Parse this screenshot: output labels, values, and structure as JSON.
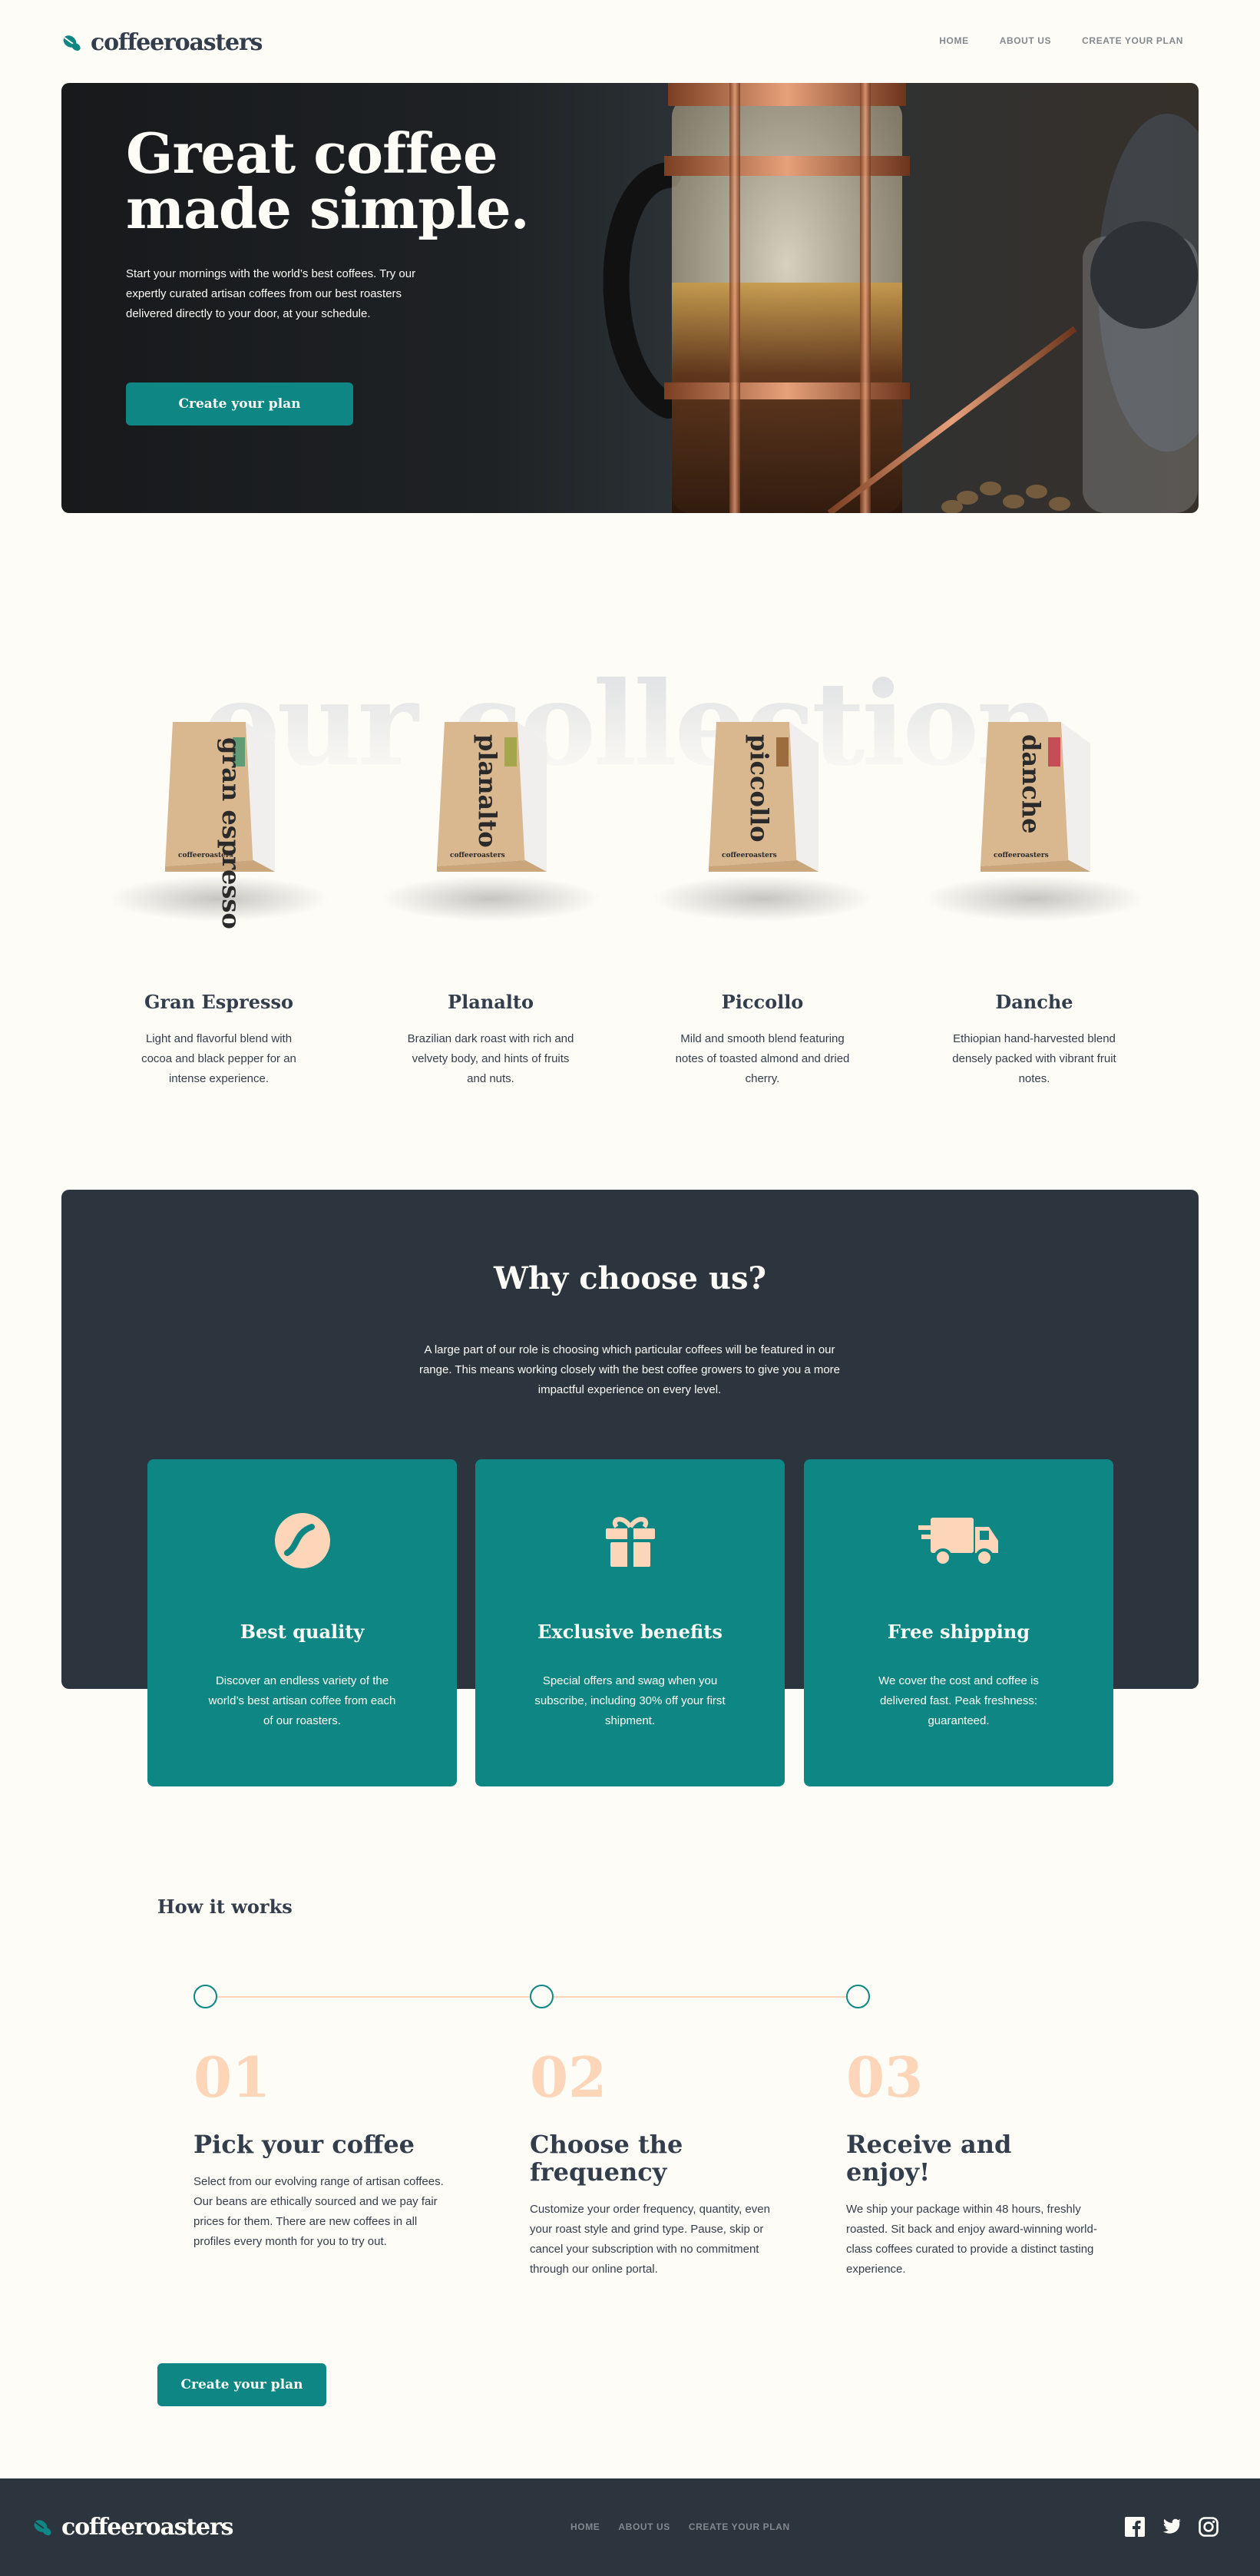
{
  "brand": {
    "name": "coffeeroasters"
  },
  "nav": {
    "home": "HOME",
    "about": "ABOUT US",
    "create": "CREATE YOUR PLAN"
  },
  "hero": {
    "title": "Great coffee made simple.",
    "text": "Start your mornings with the world’s best coffees. Try our expertly curated artisan coffees from our best roasters delivered directly to your door, at your schedule.",
    "button": "Create your plan"
  },
  "collection": {
    "heading": "our collection",
    "items": [
      {
        "bag_label": "gran espresso",
        "name": "Gran Espresso",
        "desc": "Light and flavorful blend with cocoa and black pepper for an intense experience.",
        "tag_color": "#5E9C77"
      },
      {
        "bag_label": "planalto",
        "name": "Planalto",
        "desc": "Brazilian dark roast with rich and velvety body, and hints of fruits and nuts.",
        "tag_color": "#A3A64A"
      },
      {
        "bag_label": "piccollo",
        "name": "Piccollo",
        "desc": "Mild and smooth blend featuring notes of toasted almond and dried cherry.",
        "tag_color": "#9C6B3E"
      },
      {
        "bag_label": "danche",
        "name": "Danche",
        "desc": "Ethiopian hand-harvested blend densely packed with vibrant fruit notes.",
        "tag_color": "#C44D58"
      }
    ],
    "bag_brand": "coffeeroasters"
  },
  "why": {
    "title": "Why choose us?",
    "text": "A large part of our role is choosing which particular coffees will be featured in our range. This means working closely with the best coffee growers to give you a more impactful experience on every level.",
    "cards": [
      {
        "icon": "coffee-bean-icon",
        "title": "Best quality",
        "text": "Discover an endless variety of the world’s best artisan coffee from each of our roasters."
      },
      {
        "icon": "gift-icon",
        "title": "Exclusive benefits",
        "text": "Special offers and swag when you subscribe, including 30% off your first shipment."
      },
      {
        "icon": "truck-icon",
        "title": "Free shipping",
        "text": "We cover the cost and coffee is delivered fast. Peak freshness: guaranteed."
      }
    ]
  },
  "how": {
    "title": "How it works",
    "steps": [
      {
        "num": "01",
        "title": "Pick your coffee",
        "text": "Select from our evolving range of artisan coffees. Our beans are ethically sourced and we pay fair prices for them. There are new coffees in all profiles every month for you to try out."
      },
      {
        "num": "02",
        "title": "Choose the frequency",
        "text": "Customize your order frequency, quantity, even your roast style and grind type. Pause, skip or cancel your subscription with no commitment through our online portal."
      },
      {
        "num": "03",
        "title": "Receive and enjoy!",
        "text": "We ship your package within 48 hours, freshly roasted. Sit back and enjoy award-winning world-class coffees curated to provide a distinct tasting experience."
      }
    ],
    "button": "Create your plan"
  },
  "footer": {
    "nav": {
      "home": "HOME",
      "about": "ABOUT US",
      "create": "CREATE YOUR PLAN"
    },
    "social": [
      "facebook-icon",
      "twitter-icon",
      "instagram-icon"
    ]
  },
  "colors": {
    "accent": "#0E8784",
    "dark": "#2C343E",
    "cream": "#FEFCF7",
    "peach": "#FDD6BA",
    "grey": "#83888F"
  }
}
